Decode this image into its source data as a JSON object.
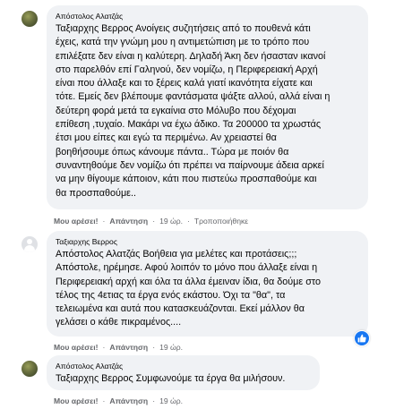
{
  "comments": [
    {
      "author": "Απόστολος Αλατζάς",
      "text": "Ταξιαρχης Βερρος Ανοίγεις συζητήσεις από το πουθενά κάτι\nέχεις, κατά την γνώμη μου η αντιμετώπιση με το τρόπο που\nεπιλέξατε δεν είναι η καλύτερη. Δηλαδή Άκη δεν ήσασταν ικανοί\nστο παρελθόν επί Γαληνού, δεν νομίζω, η Περιφερειακή Αρχή\nείναι που άλλαξε και το ξέρεις καλά γιατί ικανότητα είχατε και\nτότε. Εμείς δεν βλέπουμε φαντάσματα ψάξτε αλλού, αλλά είναι η\nδεύτερη φορά μετά τα εγκαίνια στο Μόλυβο που δέχομαι\nεπίθεση ,τυχαίο. Μακάρι να έχω άδικο. Τα 200000 τα χρωστάς\nέτσι μου είπες και εγώ τα περιμένω. Αν χρειαστεί θα\nβοηθήσουμε όπως κάνουμε πάντα.. Τώρα με ποιόν θα\nσυναντηθούμε δεν νομίζω ότι πρέπει να παίρνουμε άδεια αρκεί\nνα μην θίγουμε κάποιον, κάτι που πιστεύω προσπαθούμε και\nθα προσπαθούμε..",
      "like_label": "Μου αρέσει!",
      "reply_label": "Απάντηση",
      "time": "19 ώρ.",
      "translate_label": "Τροποποιήθηκε"
    },
    {
      "author": "Ταξιαρχης Βερρος",
      "text": "Απόστολος Αλατζάς Βοήθεια για μελέτες και προτάσεις;;;\nΑπόστολε, ηρέμησε. Αφού λοιπόν το μόνο που άλλαξε είναι η\nΠεριφερειακή αρχή και όλα τα άλλα έμειναν ίδια, θα δούμε στο\nτέλος της 4ετιας τα έργα ενός εκάστου. Όχι τα \"θα\", τα\nτελειωμένα και αυτά που κατασκευάζονται. Εκεί μάλλον θα\nγελάσει ο κάθε πικραμένος....",
      "like_label": "Μου αρέσει!",
      "reply_label": "Απάντηση",
      "time": "19 ώρ.",
      "reaction_icon": "like-thumb-icon",
      "reaction_color": "#1877f2"
    },
    {
      "author": "Απόστολος Αλατζάς",
      "text": "Ταξιαρχης Βερρος Συμφωνούμε τα έργα θα μιλήσουν.",
      "like_label": "Μου αρέσει!",
      "reply_label": "Απάντηση",
      "time": "19 ώρ."
    }
  ]
}
